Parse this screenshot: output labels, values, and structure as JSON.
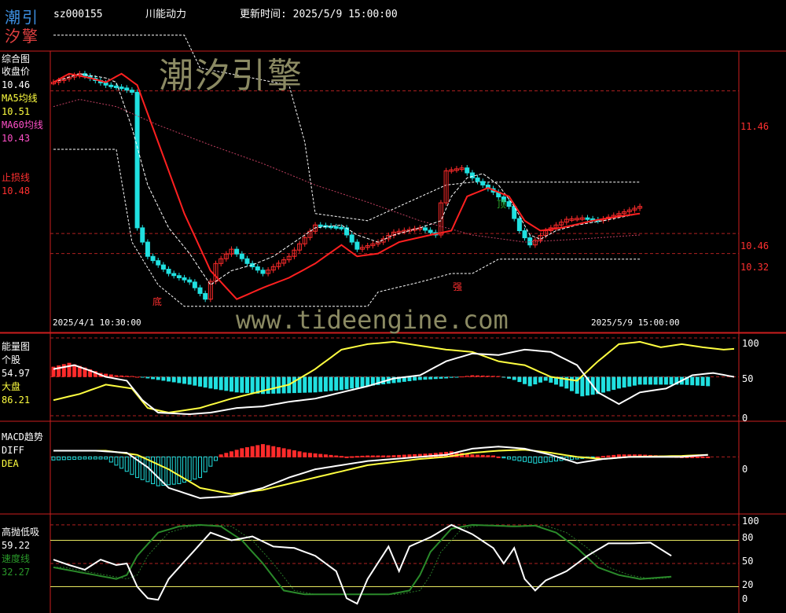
{
  "header": {
    "logo_top": "潮引",
    "logo_bottom": "汐擎",
    "code": "sz000155",
    "name": "川能动力",
    "update_time": "更新时间: 2025/5/9 15:00:00"
  },
  "watermarks": {
    "brand": "潮汐引擎",
    "url": "www.tideengine.com"
  },
  "colors": {
    "background": "#000000",
    "frame": "#cc1e1e",
    "up": "#ff2b2b",
    "down": "#20e0e0",
    "ma5": "#ffffff",
    "ma60": "#ffff40",
    "stop": "#ff2020",
    "energy_stock": "#ffffff",
    "energy_market": "#ffff40",
    "macd_diff": "#ffffff",
    "macd_dea": "#ffff40",
    "gp_main": "#ffffff",
    "gp_speed": "#2a8a2a"
  },
  "panels": {
    "main": {
      "title": "综合图",
      "close_label": "收盘价",
      "close_value": "10.46",
      "ma5_label": "MA5均线",
      "ma5_value": "10.51",
      "ma60_label": "MA60均线",
      "ma60_value": "10.43",
      "stop_label": "止损线",
      "stop_value": "10.48",
      "price_ticks": [
        "11.46",
        "10.46",
        "10.32"
      ],
      "date_start": "2025/4/1 10:30:00",
      "date_end": "2025/5/9 15:00:00",
      "top_marker": "顶",
      "bottom_marker": "底",
      "strong_marker": "强"
    },
    "energy": {
      "title": "能量图",
      "stock_label": "个股",
      "stock_value": "54.97",
      "market_label": "大盘",
      "market_value": "86.21",
      "ticks": [
        "100",
        "50",
        "0"
      ]
    },
    "macd": {
      "title": "MACD趋势",
      "diff_label": "DIFF",
      "dea_label": "DEA",
      "ticks": [
        "0"
      ]
    },
    "gp": {
      "title": "高抛低吸",
      "main_value": "59.22",
      "speed_label": "速度线",
      "speed_value": "32.27",
      "ticks": [
        "100",
        "80",
        "50",
        "20",
        "0"
      ]
    }
  },
  "chart_data": {
    "type": "line",
    "n": 100,
    "price": {
      "ylim": [
        9.8,
        11.7
      ],
      "close_keys": [
        [
          0,
          11.52
        ],
        [
          5,
          11.58
        ],
        [
          10,
          11.5
        ],
        [
          13,
          11.48
        ],
        [
          15,
          11.45
        ],
        [
          16,
          10.5
        ],
        [
          18,
          10.3
        ],
        [
          22,
          10.18
        ],
        [
          26,
          10.12
        ],
        [
          29,
          10.0
        ],
        [
          31,
          10.25
        ],
        [
          34,
          10.35
        ],
        [
          37,
          10.25
        ],
        [
          40,
          10.18
        ],
        [
          45,
          10.3
        ],
        [
          50,
          10.52
        ],
        [
          55,
          10.5
        ],
        [
          58,
          10.35
        ],
        [
          62,
          10.4
        ],
        [
          65,
          10.47
        ],
        [
          70,
          10.5
        ],
        [
          73,
          10.45
        ],
        [
          75,
          10.9
        ],
        [
          78,
          10.92
        ],
        [
          80,
          10.85
        ],
        [
          84,
          10.75
        ],
        [
          87,
          10.65
        ],
        [
          89,
          10.48
        ],
        [
          91,
          10.38
        ],
        [
          94,
          10.48
        ],
        [
          98,
          10.56
        ],
        [
          101,
          10.57
        ],
        [
          104,
          10.55
        ],
        [
          108,
          10.6
        ],
        [
          112,
          10.65
        ]
      ],
      "ma5_keys": [
        [
          0,
          11.52
        ],
        [
          5,
          11.58
        ],
        [
          10,
          11.55
        ],
        [
          12,
          11.52
        ],
        [
          15,
          11.2
        ],
        [
          18,
          10.8
        ],
        [
          22,
          10.5
        ],
        [
          26,
          10.32
        ],
        [
          30,
          10.1
        ],
        [
          34,
          10.2
        ],
        [
          38,
          10.24
        ],
        [
          42,
          10.3
        ],
        [
          46,
          10.4
        ],
        [
          50,
          10.5
        ],
        [
          55,
          10.52
        ],
        [
          58,
          10.45
        ],
        [
          62,
          10.4
        ],
        [
          65,
          10.45
        ],
        [
          70,
          10.5
        ],
        [
          74,
          10.55
        ],
        [
          76,
          10.72
        ],
        [
          79,
          10.85
        ],
        [
          82,
          10.88
        ],
        [
          85,
          10.8
        ],
        [
          88,
          10.65
        ],
        [
          91,
          10.45
        ],
        [
          93,
          10.42
        ],
        [
          96,
          10.48
        ],
        [
          100,
          10.52
        ],
        [
          105,
          10.55
        ],
        [
          112,
          10.6
        ]
      ],
      "stop_keys": [
        [
          0,
          11.52
        ],
        [
          3,
          11.58
        ],
        [
          7,
          11.55
        ],
        [
          10,
          11.52
        ],
        [
          13,
          11.58
        ],
        [
          16,
          11.5
        ],
        [
          20,
          11.1
        ],
        [
          25,
          10.6
        ],
        [
          30,
          10.2
        ],
        [
          35,
          10.0
        ],
        [
          40,
          10.08
        ],
        [
          45,
          10.15
        ],
        [
          50,
          10.25
        ],
        [
          55,
          10.38
        ],
        [
          58,
          10.3
        ],
        [
          62,
          10.32
        ],
        [
          66,
          10.4
        ],
        [
          72,
          10.45
        ],
        [
          76,
          10.48
        ],
        [
          79,
          10.72
        ],
        [
          83,
          10.78
        ],
        [
          87,
          10.72
        ],
        [
          90,
          10.55
        ],
        [
          93,
          10.48
        ],
        [
          97,
          10.5
        ],
        [
          103,
          10.55
        ],
        [
          108,
          10.58
        ],
        [
          112,
          10.6
        ]
      ],
      "ma60_keys": [
        [
          0,
          11.35
        ],
        [
          5,
          11.4
        ],
        [
          12,
          11.35
        ],
        [
          20,
          11.22
        ],
        [
          30,
          11.08
        ],
        [
          40,
          10.95
        ],
        [
          50,
          10.8
        ],
        [
          60,
          10.68
        ],
        [
          70,
          10.55
        ],
        [
          75,
          10.5
        ],
        [
          80,
          10.45
        ],
        [
          90,
          10.4
        ],
        [
          100,
          10.42
        ],
        [
          112,
          10.45
        ]
      ]
    },
    "energy": {
      "ylim": [
        0,
        100
      ],
      "stock_keys": [
        [
          0,
          60
        ],
        [
          4,
          65
        ],
        [
          7,
          58
        ],
        [
          10,
          50
        ],
        [
          14,
          45
        ],
        [
          17,
          20
        ],
        [
          20,
          4
        ],
        [
          26,
          2
        ],
        [
          30,
          4
        ],
        [
          35,
          10
        ],
        [
          40,
          12
        ],
        [
          45,
          18
        ],
        [
          50,
          22
        ],
        [
          55,
          30
        ],
        [
          60,
          38
        ],
        [
          65,
          48
        ],
        [
          70,
          52
        ],
        [
          75,
          70
        ],
        [
          80,
          80
        ],
        [
          85,
          78
        ],
        [
          90,
          85
        ],
        [
          95,
          82
        ],
        [
          100,
          65
        ],
        [
          104,
          30
        ],
        [
          108,
          15
        ],
        [
          112,
          30
        ],
        [
          117,
          35
        ],
        [
          122,
          52
        ],
        [
          126,
          55
        ],
        [
          130,
          50
        ]
      ],
      "market_keys": [
        [
          0,
          20
        ],
        [
          5,
          28
        ],
        [
          10,
          40
        ],
        [
          15,
          35
        ],
        [
          18,
          10
        ],
        [
          22,
          4
        ],
        [
          28,
          10
        ],
        [
          34,
          22
        ],
        [
          40,
          32
        ],
        [
          45,
          40
        ],
        [
          50,
          60
        ],
        [
          55,
          85
        ],
        [
          60,
          92
        ],
        [
          65,
          95
        ],
        [
          70,
          90
        ],
        [
          75,
          85
        ],
        [
          80,
          82
        ],
        [
          85,
          70
        ],
        [
          90,
          65
        ],
        [
          95,
          50
        ],
        [
          100,
          45
        ],
        [
          104,
          70
        ],
        [
          108,
          92
        ],
        [
          112,
          95
        ],
        [
          116,
          88
        ],
        [
          120,
          92
        ],
        [
          124,
          88
        ],
        [
          128,
          85
        ],
        [
          130,
          86
        ]
      ],
      "bars_keys": [
        [
          0,
          63
        ],
        [
          3,
          68
        ],
        [
          6,
          62
        ],
        [
          9,
          55
        ],
        [
          12,
          52
        ],
        [
          15,
          51
        ],
        [
          18,
          48
        ],
        [
          22,
          44
        ],
        [
          26,
          40
        ],
        [
          30,
          35
        ],
        [
          35,
          30
        ],
        [
          40,
          28
        ],
        [
          45,
          29
        ],
        [
          50,
          30
        ],
        [
          55,
          33
        ],
        [
          60,
          38
        ],
        [
          65,
          42
        ],
        [
          70,
          46
        ],
        [
          75,
          48
        ],
        [
          80,
          52
        ],
        [
          85,
          51
        ],
        [
          88,
          46
        ],
        [
          91,
          38
        ],
        [
          94,
          45
        ],
        [
          98,
          35
        ],
        [
          101,
          25
        ],
        [
          104,
          28
        ],
        [
          108,
          35
        ],
        [
          112,
          40
        ],
        [
          116,
          40
        ],
        [
          120,
          40
        ],
        [
          125,
          38
        ]
      ]
    },
    "macd": {
      "ylim": [
        -0.5,
        0.3
      ],
      "diff_keys": [
        [
          0,
          0.06
        ],
        [
          8,
          0.06
        ],
        [
          14,
          0.04
        ],
        [
          18,
          -0.1
        ],
        [
          22,
          -0.3
        ],
        [
          28,
          -0.4
        ],
        [
          34,
          -0.38
        ],
        [
          40,
          -0.3
        ],
        [
          45,
          -0.2
        ],
        [
          50,
          -0.12
        ],
        [
          55,
          -0.08
        ],
        [
          60,
          -0.04
        ],
        [
          65,
          -0.02
        ],
        [
          70,
          0.0
        ],
        [
          75,
          0.02
        ],
        [
          80,
          0.08
        ],
        [
          85,
          0.1
        ],
        [
          90,
          0.08
        ],
        [
          95,
          0.02
        ],
        [
          100,
          -0.06
        ],
        [
          105,
          -0.02
        ],
        [
          110,
          0.0
        ],
        [
          120,
          0.0
        ],
        [
          125,
          0.02
        ]
      ],
      "dea_keys": [
        [
          0,
          0.06
        ],
        [
          10,
          0.06
        ],
        [
          16,
          0.02
        ],
        [
          22,
          -0.12
        ],
        [
          28,
          -0.3
        ],
        [
          34,
          -0.36
        ],
        [
          40,
          -0.32
        ],
        [
          45,
          -0.26
        ],
        [
          50,
          -0.2
        ],
        [
          55,
          -0.14
        ],
        [
          60,
          -0.08
        ],
        [
          65,
          -0.05
        ],
        [
          70,
          -0.02
        ],
        [
          75,
          0.0
        ],
        [
          80,
          0.04
        ],
        [
          85,
          0.06
        ],
        [
          90,
          0.07
        ],
        [
          95,
          0.04
        ],
        [
          100,
          0.0
        ],
        [
          105,
          -0.02
        ],
        [
          110,
          0.0
        ],
        [
          120,
          0.01
        ],
        [
          125,
          0.02
        ]
      ],
      "hist_keys": [
        [
          0,
          -0.03
        ],
        [
          6,
          -0.02
        ],
        [
          10,
          -0.02
        ],
        [
          16,
          -0.2
        ],
        [
          20,
          -0.28
        ],
        [
          24,
          -0.26
        ],
        [
          28,
          -0.2
        ],
        [
          32,
          0.02
        ],
        [
          36,
          0.08
        ],
        [
          40,
          0.12
        ],
        [
          44,
          0.08
        ],
        [
          48,
          0.04
        ],
        [
          52,
          0.02
        ],
        [
          56,
          0.0
        ],
        [
          60,
          0.01
        ],
        [
          64,
          0.01
        ],
        [
          68,
          0.02
        ],
        [
          72,
          0.03
        ],
        [
          76,
          0.05
        ],
        [
          80,
          0.02
        ],
        [
          84,
          0.01
        ],
        [
          88,
          -0.03
        ],
        [
          92,
          -0.06
        ],
        [
          96,
          -0.04
        ],
        [
          100,
          -0.02
        ],
        [
          104,
          0.0
        ],
        [
          108,
          0.02
        ],
        [
          112,
          0.02
        ],
        [
          116,
          0.01
        ],
        [
          120,
          0.0
        ]
      ]
    },
    "gp": {
      "ylim": [
        -8,
        108
      ],
      "main_keys": [
        [
          0,
          55
        ],
        [
          3,
          48
        ],
        [
          6,
          42
        ],
        [
          9,
          55
        ],
        [
          12,
          48
        ],
        [
          14,
          50
        ],
        [
          16,
          20
        ],
        [
          18,
          5
        ],
        [
          20,
          3
        ],
        [
          22,
          30
        ],
        [
          26,
          60
        ],
        [
          30,
          90
        ],
        [
          34,
          80
        ],
        [
          38,
          85
        ],
        [
          42,
          72
        ],
        [
          46,
          70
        ],
        [
          50,
          60
        ],
        [
          54,
          40
        ],
        [
          56,
          5
        ],
        [
          58,
          -2
        ],
        [
          60,
          30
        ],
        [
          64,
          72
        ],
        [
          66,
          40
        ],
        [
          68,
          72
        ],
        [
          72,
          84
        ],
        [
          76,
          100
        ],
        [
          80,
          88
        ],
        [
          84,
          70
        ],
        [
          86,
          50
        ],
        [
          88,
          70
        ],
        [
          90,
          30
        ],
        [
          92,
          15
        ],
        [
          94,
          28
        ],
        [
          98,
          40
        ],
        [
          102,
          60
        ],
        [
          106,
          76
        ],
        [
          110,
          76
        ],
        [
          114,
          77
        ],
        [
          118,
          60
        ]
      ],
      "speed_keys": [
        [
          0,
          45
        ],
        [
          4,
          40
        ],
        [
          8,
          35
        ],
        [
          12,
          30
        ],
        [
          14,
          35
        ],
        [
          16,
          60
        ],
        [
          20,
          90
        ],
        [
          24,
          98
        ],
        [
          28,
          100
        ],
        [
          32,
          98
        ],
        [
          36,
          80
        ],
        [
          40,
          50
        ],
        [
          44,
          15
        ],
        [
          48,
          10
        ],
        [
          52,
          10
        ],
        [
          56,
          10
        ],
        [
          60,
          10
        ],
        [
          64,
          10
        ],
        [
          68,
          15
        ],
        [
          70,
          35
        ],
        [
          72,
          65
        ],
        [
          76,
          95
        ],
        [
          80,
          100
        ],
        [
          84,
          99
        ],
        [
          88,
          98
        ],
        [
          92,
          99
        ],
        [
          96,
          90
        ],
        [
          100,
          70
        ],
        [
          104,
          45
        ],
        [
          108,
          35
        ],
        [
          112,
          30
        ],
        [
          118,
          33
        ]
      ]
    }
  }
}
